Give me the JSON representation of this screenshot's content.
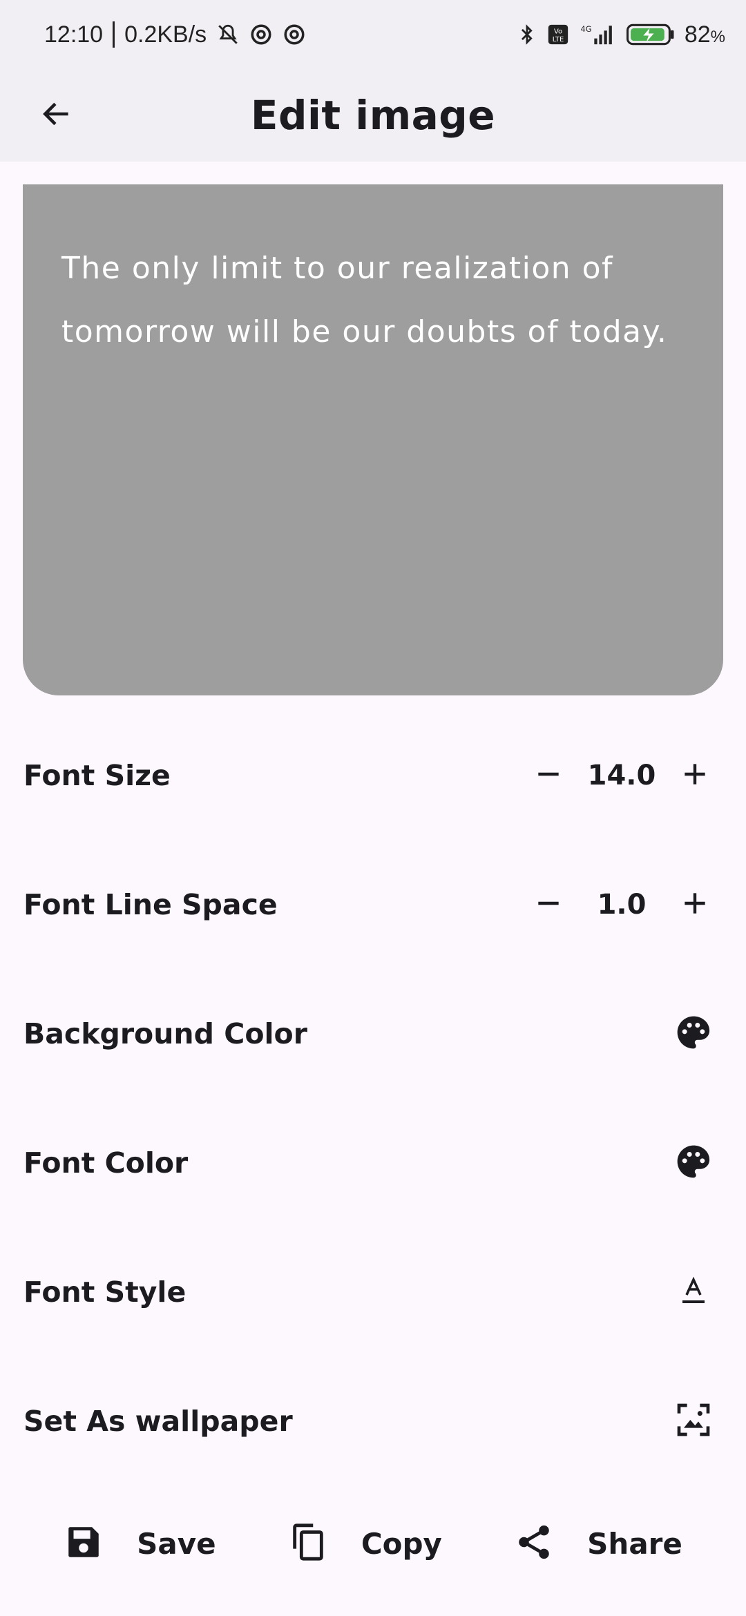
{
  "status_bar": {
    "time": "12:10",
    "net_speed": "0.2KB/s",
    "battery_percent": "82",
    "battery_unit": "%"
  },
  "app_bar": {
    "title": "Edit image",
    "back_icon": "arrow-back-icon"
  },
  "preview": {
    "quote": "The only limit to our realization of tomorrow will be our doubts of today.",
    "background_color": "#9e9e9e",
    "text_color": "#ffffff"
  },
  "settings": {
    "font_size": {
      "label": "Font Size",
      "value": "14.0"
    },
    "line_space": {
      "label": "Font Line Space",
      "value": "1.0"
    },
    "background_color": {
      "label": "Background Color",
      "icon": "palette-icon"
    },
    "font_color": {
      "label": "Font Color",
      "icon": "palette-icon"
    },
    "font_style": {
      "label": "Font Style",
      "icon": "font-style-icon"
    },
    "wallpaper": {
      "label": "Set As wallpaper",
      "icon": "wallpaper-icon"
    }
  },
  "actions": {
    "save": {
      "label": "Save",
      "icon": "save-icon"
    },
    "copy": {
      "label": "Copy",
      "icon": "copy-icon"
    },
    "share": {
      "label": "Share",
      "icon": "share-icon"
    }
  }
}
